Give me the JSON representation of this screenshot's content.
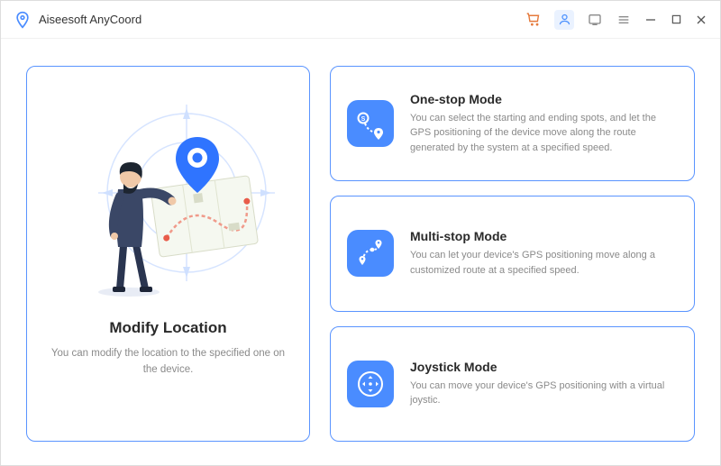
{
  "app": {
    "title": "Aiseesoft AnyCoord"
  },
  "titlebar": {
    "cart_icon": "cart-icon",
    "person_icon": "person-icon",
    "feedback_icon": "feedback-icon",
    "menu_icon": "menu-icon",
    "minimize_icon": "minimize-icon",
    "maximize_icon": "maximize-icon",
    "close_icon": "close-icon"
  },
  "main": {
    "title": "Modify Location",
    "desc": "You can modify the location to the specified one on the device."
  },
  "modes": [
    {
      "icon": "one-stop-icon",
      "title": "One-stop Mode",
      "desc": "You can select the starting and ending spots, and let the GPS positioning of the device move along the route generated by the system at a specified speed."
    },
    {
      "icon": "multi-stop-icon",
      "title": "Multi-stop Mode",
      "desc": "You can let your device's GPS positioning move along a customized route at a specified speed."
    },
    {
      "icon": "joystick-icon",
      "title": "Joystick Mode",
      "desc": "You can move your device's GPS positioning with a virtual joystic."
    }
  ],
  "colors": {
    "accent": "#4a8cff",
    "border": "#5a94ff",
    "text_muted": "#8a8a8a"
  }
}
